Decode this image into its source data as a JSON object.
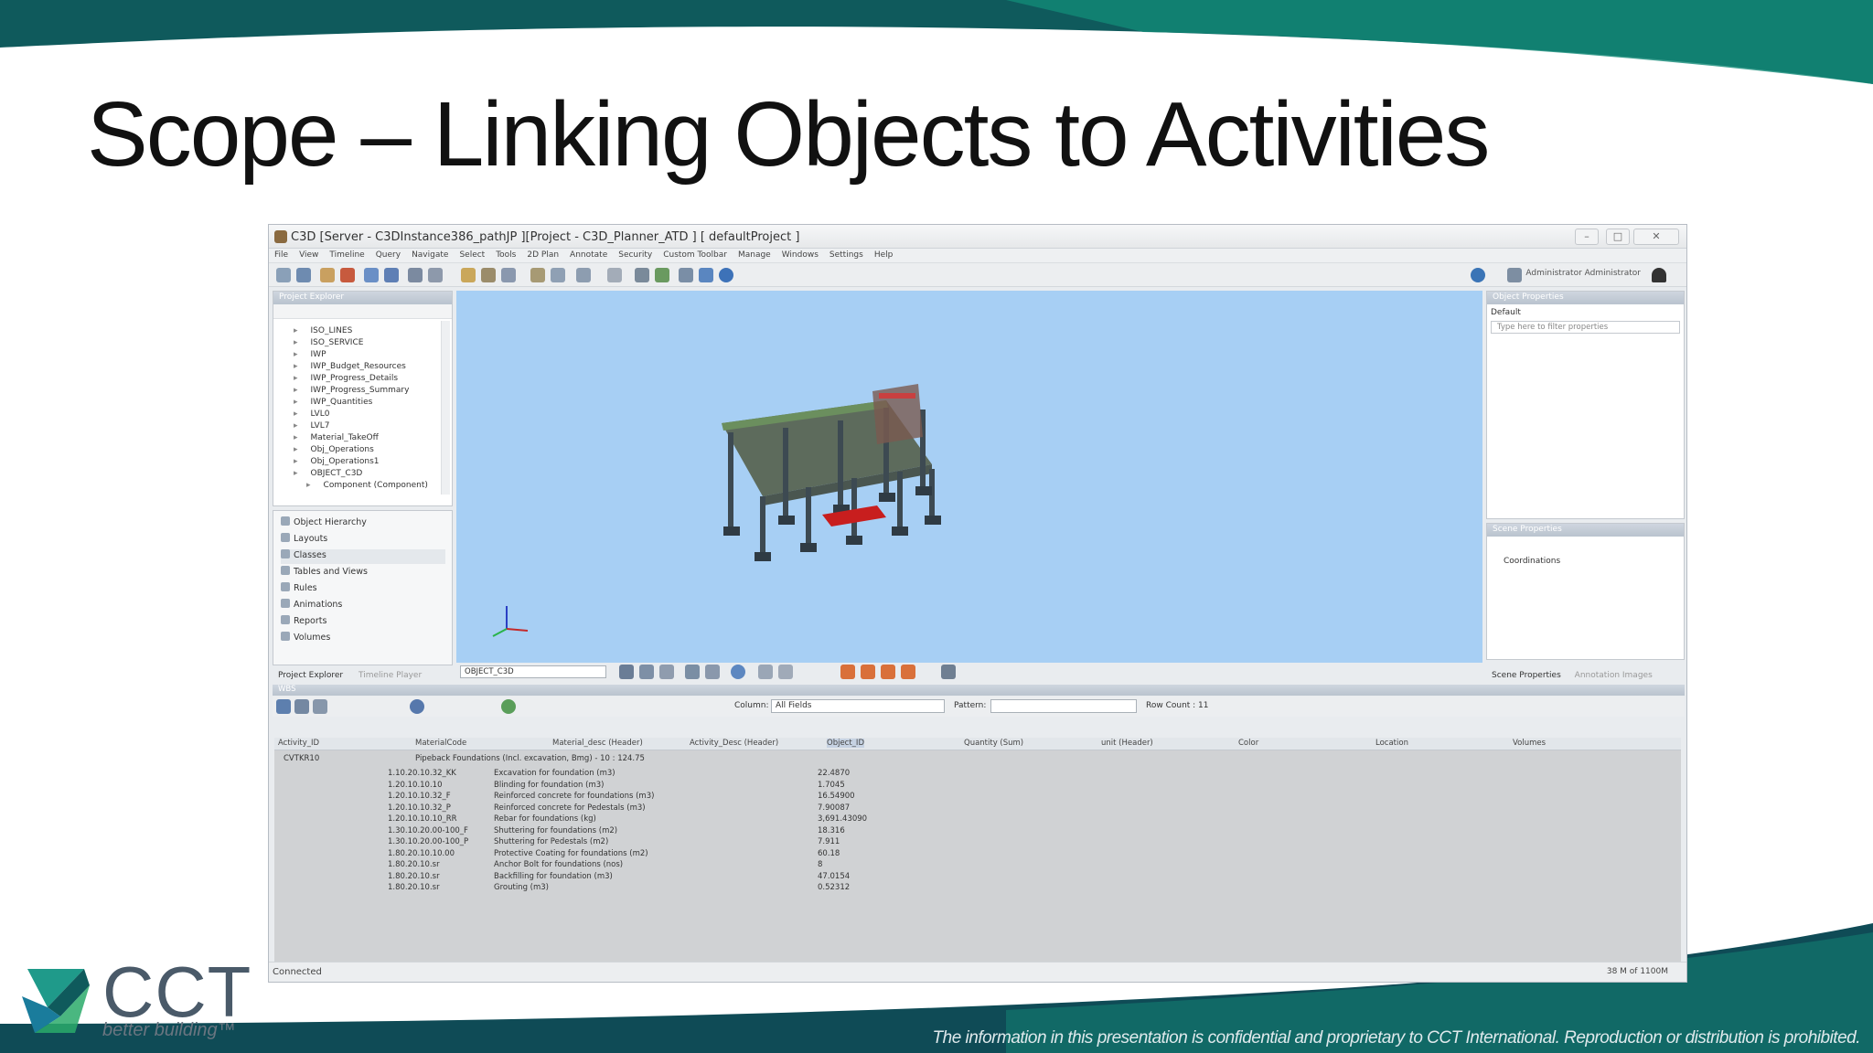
{
  "slide": {
    "title": "Scope – Linking Objects to Activities"
  },
  "app": {
    "window_title": "C3D [Server - C3DInstance386_pathJP ][Project - C3D_Planner_ATD ] [ defaultProject ]",
    "menu": [
      "File",
      "View",
      "Timeline",
      "Query",
      "Navigate",
      "Select",
      "Tools",
      "2D Plan",
      "Annotate",
      "Security",
      "Custom Toolbar",
      "Manage",
      "Windows",
      "Settings",
      "Help"
    ],
    "user": "Administrator Administrator",
    "project_explorer": {
      "title": "Project Explorer",
      "tree": [
        "ISO_LINES",
        "ISO_SERVICE",
        "IWP",
        "IWP_Budget_Resources",
        "IWP_Progress_Details",
        "IWP_Progress_Summary",
        "IWP_Quantities",
        "LVL0",
        "LVL7",
        "Material_TakeOff",
        "Obj_Operations",
        "Obj_Operations1",
        "OBJECT_C3D",
        "Component (Component)"
      ]
    },
    "navigator": [
      "Object Hierarchy",
      "Layouts",
      "Classes",
      "Tables and Views",
      "Rules",
      "Animations",
      "Reports",
      "Volumes"
    ],
    "explorer_tabs": [
      "Project Explorer",
      "Timeline Player"
    ],
    "viewport": {
      "selector": "OBJECT_C3D"
    },
    "object_properties": {
      "title": "Object Properties",
      "default": "Default",
      "filter_placeholder": "Type here to filter properties"
    },
    "scene_properties": {
      "title": "Scene Properties",
      "item": "Coordinations"
    },
    "properties_tabs": [
      "Scene Properties",
      "Annotation Images"
    ],
    "grid": {
      "title": "WBS",
      "column_label": "Column:",
      "column_value": "All Fields",
      "pattern_label": "Pattern:",
      "row_count": "Row Count : 11",
      "columns": [
        "Activity_ID",
        "MaterialCode",
        "Material_desc (Header)",
        "Activity_Desc (Header)",
        "Object_ID",
        "Quantity (Sum)",
        "unit (Header)",
        "Color",
        "Location",
        "Volumes"
      ],
      "group": {
        "activity": "CVTKR10",
        "description": "Pipeback Foundations (Incl. excavation, Bmg) - 10 : 124.75"
      },
      "rows": [
        {
          "code": "1.10.20.10.32_KK",
          "desc": "Excavation for foundation (m3)",
          "qty": "22.4870"
        },
        {
          "code": "1.20.10.10.10",
          "desc": "Blinding for foundation (m3)",
          "qty": "1.7045"
        },
        {
          "code": "1.20.10.10.32_F",
          "desc": "Reinforced concrete for foundations (m3)",
          "qty": "16.54900"
        },
        {
          "code": "1.20.10.10.32_P",
          "desc": "Reinforced concrete for Pedestals (m3)",
          "qty": "7.90087"
        },
        {
          "code": "1.20.10.10.10_RR",
          "desc": "Rebar for foundations (kg)",
          "qty": "3,691.43090"
        },
        {
          "code": "1.30.10.20.00-100_F",
          "desc": "Shuttering for foundations (m2)",
          "qty": "18.316"
        },
        {
          "code": "1.30.10.20.00-100_P",
          "desc": "Shuttering for Pedestals (m2)",
          "qty": "7.911"
        },
        {
          "code": "1.80.20.10.10.00",
          "desc": "Protective Coating for foundations (m2)",
          "qty": "60.18"
        },
        {
          "code": "1.80.20.10.sr",
          "desc": "Anchor Bolt for foundations (nos)",
          "qty": "8"
        },
        {
          "code": "1.80.20.10.sr",
          "desc": "Backfilling for foundation (m3)",
          "qty": "47.0154"
        },
        {
          "code": "1.80.20.10.sr",
          "desc": "Grouting (m3)",
          "qty": "0.52312"
        }
      ]
    },
    "status": {
      "left": "Connected",
      "right": "38 M of 1100M"
    }
  },
  "footer": {
    "logo": "CCT",
    "tagline": "better building™",
    "confidentiality": "The information in this presentation is confidential and proprietary to CCT International. Reproduction or distribution is prohibited."
  }
}
